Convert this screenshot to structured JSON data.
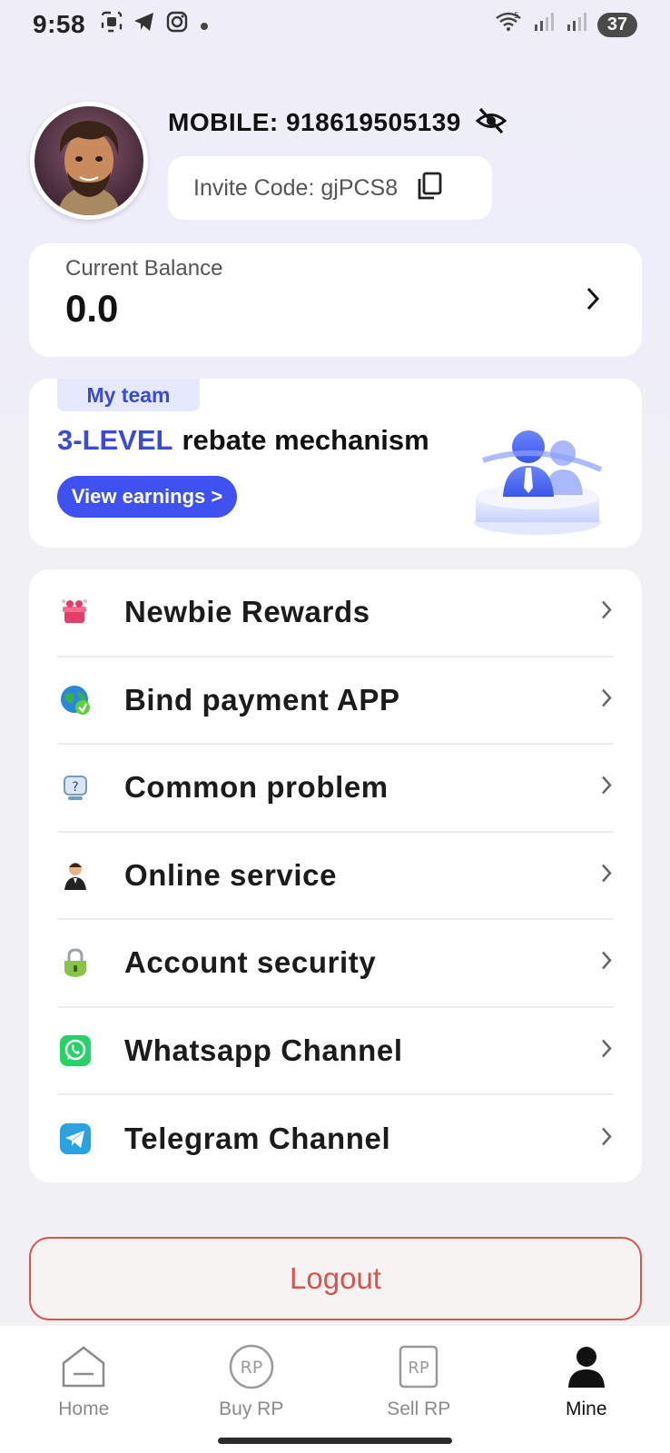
{
  "status_bar": {
    "time": "9:58",
    "battery": "37",
    "network": "5"
  },
  "profile": {
    "mobile_label": "MOBILE: 918619505139",
    "invite_label": "Invite Code: gjPCS8"
  },
  "balance": {
    "title": "Current Balance",
    "value": "0.0"
  },
  "team": {
    "tag": "My team",
    "headline_accent": "3-LEVEL",
    "headline_rest": "rebate mechanism",
    "button": "View earnings >"
  },
  "menu": {
    "items": [
      {
        "label": "Newbie Rewards",
        "icon": "gift-icon"
      },
      {
        "label": "Bind payment APP",
        "icon": "globe-icon"
      },
      {
        "label": "Common problem",
        "icon": "question-icon"
      },
      {
        "label": "Online service",
        "icon": "support-agent-icon"
      },
      {
        "label": "Account security",
        "icon": "lock-icon"
      },
      {
        "label": "Whatsapp Channel",
        "icon": "whatsapp-icon"
      },
      {
        "label": "Telegram Channel",
        "icon": "telegram-icon"
      }
    ]
  },
  "logout": "Logout",
  "nav": {
    "items": [
      {
        "label": "Home",
        "icon": "home-icon"
      },
      {
        "label": "Buy RP",
        "icon": "buy-rp-icon"
      },
      {
        "label": "Sell RP",
        "icon": "sell-rp-icon"
      },
      {
        "label": "Mine",
        "icon": "person-icon",
        "active": true
      }
    ]
  },
  "colors": {
    "accent": "#3f51f0",
    "logout": "#d9534f",
    "whatsapp": "#25d366",
    "telegram": "#2aa3e0"
  }
}
